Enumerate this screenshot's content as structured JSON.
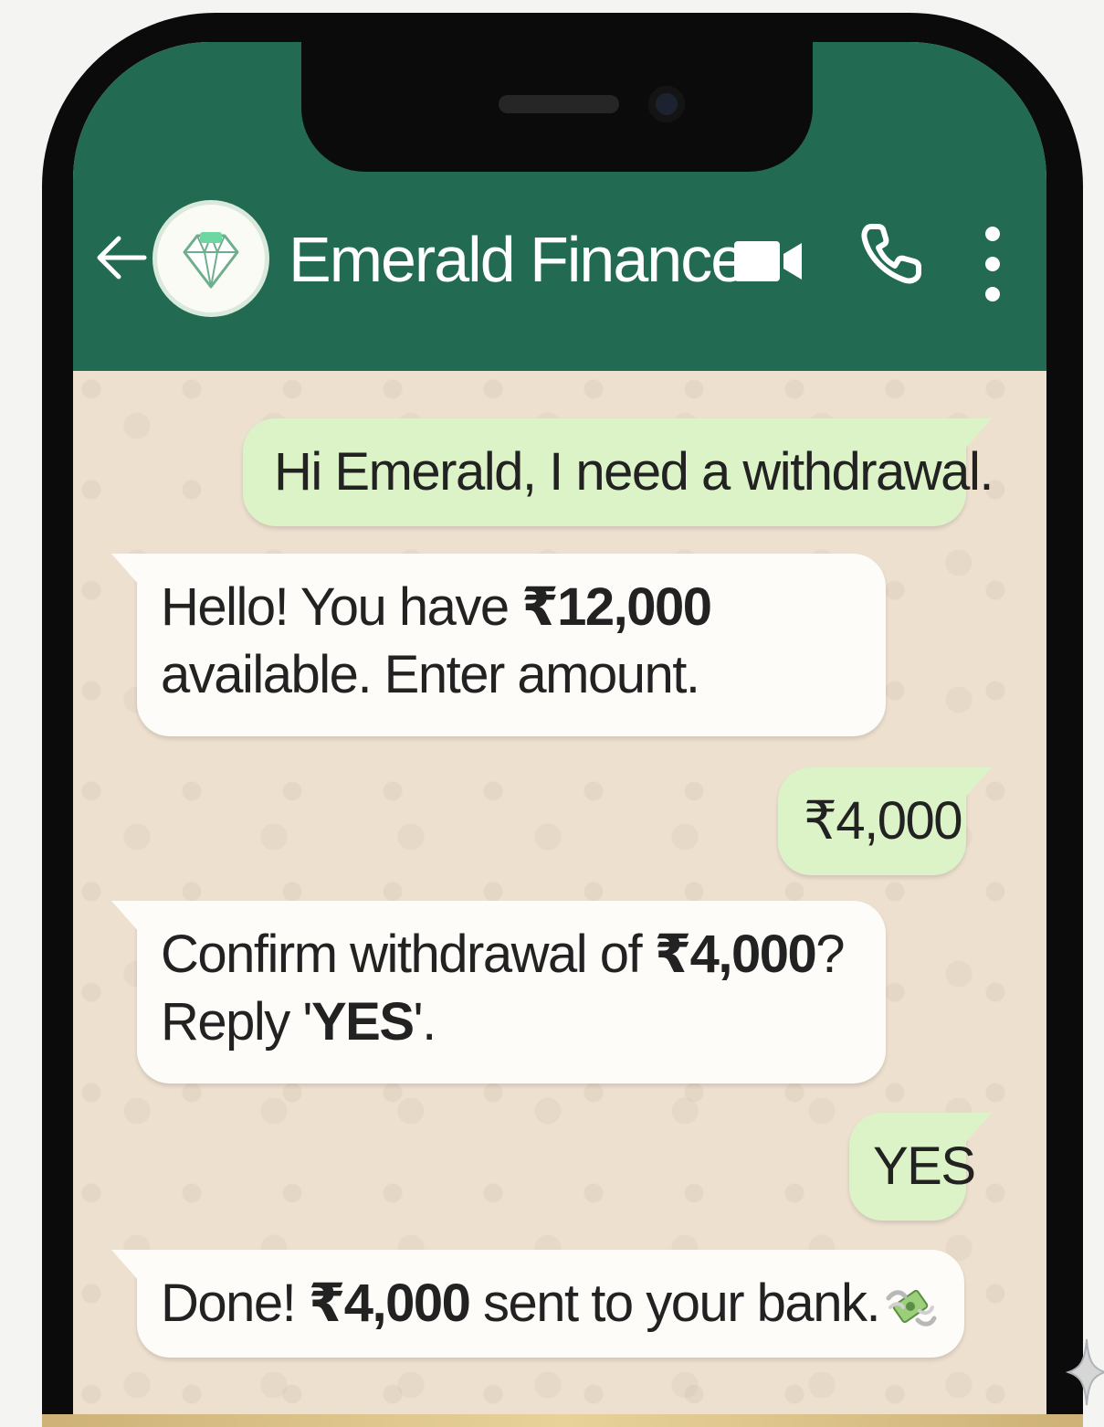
{
  "header": {
    "contact_name": "Emerald Finance",
    "back_icon": "arrow-left-icon",
    "avatar_icon": "diamond-icon",
    "video_icon": "video-camera-icon",
    "call_icon": "phone-icon",
    "menu_icon": "more-vertical-icon"
  },
  "messages": [
    {
      "direction": "outgoing",
      "line1": "Hi Emerald, I need a withdrawal."
    },
    {
      "direction": "incoming",
      "pre": "Hello! You have ",
      "bold": "₹12,000",
      "line2": "available. Enter amount."
    },
    {
      "direction": "outgoing",
      "line1": "₹4,000"
    },
    {
      "direction": "incoming",
      "pre": "Confirm withdrawal of ",
      "bold": "₹4,000",
      "post": "?",
      "line2_pre": "Reply '",
      "line2_bold": "YES",
      "line2_post": "'."
    },
    {
      "direction": "outgoing",
      "line1": "YES"
    },
    {
      "direction": "incoming",
      "pre": "Done! ",
      "bold": "₹4,000",
      "post": " sent to your bank.",
      "icon": "money-with-wings-icon"
    }
  ],
  "colors": {
    "header_green": "#226b52",
    "chat_background": "#ede0cf",
    "outgoing_bubble": "#dcf3c8",
    "incoming_bubble": "#fdfcf9"
  }
}
